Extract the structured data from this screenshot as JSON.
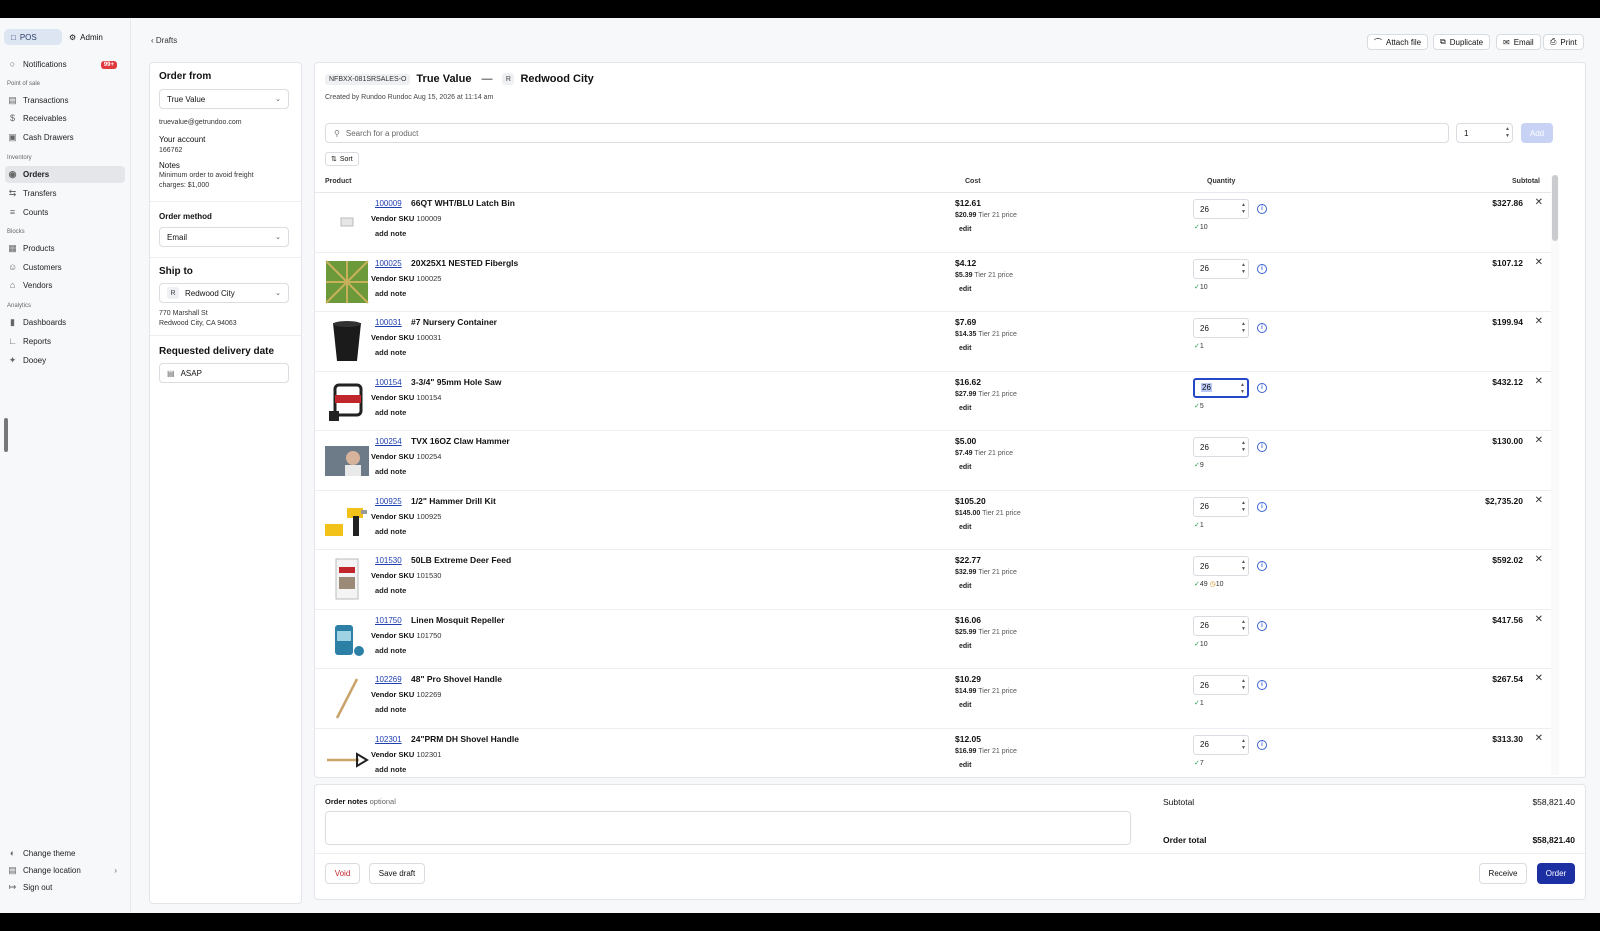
{
  "sidebar": {
    "pos_label": "POS",
    "admin_label": "Admin",
    "notifications_label": "Notifications",
    "notifications_badge": "99+",
    "section_pos": "Point of sale",
    "transactions": "Transactions",
    "receivables": "Receivables",
    "cash_drawers": "Cash Drawers",
    "section_inventory": "Inventory",
    "orders": "Orders",
    "transfers": "Transfers",
    "counts": "Counts",
    "section_blocks": "Blocks",
    "products": "Products",
    "customers": "Customers",
    "vendors": "Vendors",
    "section_analytics": "Analytics",
    "dashboards": "Dashboards",
    "reports": "Reports",
    "dooey": "Dooey",
    "change_theme": "Change theme",
    "change_location": "Change location",
    "sign_out": "Sign out"
  },
  "topbar": {
    "back_label": "Drafts",
    "attach_file": "Attach file",
    "duplicate": "Duplicate",
    "email": "Email",
    "print": "Print"
  },
  "left": {
    "order_from_title": "Order from",
    "vendor_value": "True Value",
    "vendor_email": "truevalue@getrundoo.com",
    "account_label": "Your account",
    "account_value": "166762",
    "notes_label": "Notes",
    "notes_value": "Minimum order to avoid freight charges: $1,000",
    "order_method_label": "Order method",
    "order_method_value": "Email",
    "ship_to_title": "Ship to",
    "ship_to_chip": "R",
    "ship_to_value": "Redwood City",
    "address_line1": "770 Marshall St",
    "address_line2": "Redwood City, CA 94063",
    "delivery_title": "Requested delivery date",
    "delivery_value": "ASAP"
  },
  "main": {
    "order_id": "NFBXX-081SRSALES-O",
    "vendor": "True Value",
    "dash": "—",
    "location_chip": "R",
    "location": "Redwood City",
    "created": "Created by Rundoo Rundoc Aug 15, 2026 at 11:14 am",
    "search_placeholder": "Search for a product",
    "add_qty": "1",
    "add_label": "Add",
    "sort_label": "Sort",
    "col_product": "Product",
    "col_cost": "Cost",
    "col_quantity": "Quantity",
    "col_subtotal": "Subtotal",
    "vendor_sku_label": "Vendor SKU",
    "add_note_label": "add note",
    "edit_label": "edit",
    "tier_suffix": "Tier 21 price"
  },
  "rows": [
    {
      "sku": "100009",
      "name": "66QT WHT/BLU Latch Bin",
      "cost": "$12.61",
      "tier": "$20.99",
      "qty": "26",
      "stock": "10",
      "stock2": "",
      "subtotal": "$327.86"
    },
    {
      "sku": "100025",
      "name": "20X25X1 NESTED Fibergls",
      "cost": "$4.12",
      "tier": "$5.39",
      "qty": "26",
      "stock": "10",
      "stock2": "",
      "subtotal": "$107.12"
    },
    {
      "sku": "100031",
      "name": "#7 Nursery Container",
      "cost": "$7.69",
      "tier": "$14.35",
      "qty": "26",
      "stock": "1",
      "stock2": "",
      "subtotal": "$199.94"
    },
    {
      "sku": "100154",
      "name": "3-3/4\" 95mm Hole Saw",
      "cost": "$16.62",
      "tier": "$27.99",
      "qty": "26",
      "stock": "5",
      "stock2": "",
      "subtotal": "$432.12"
    },
    {
      "sku": "100254",
      "name": "TVX 16OZ Claw Hammer",
      "cost": "$5.00",
      "tier": "$7.49",
      "qty": "26",
      "stock": "9",
      "stock2": "",
      "subtotal": "$130.00"
    },
    {
      "sku": "100925",
      "name": "1/2\" Hammer Drill Kit",
      "cost": "$105.20",
      "tier": "$145.00",
      "qty": "26",
      "stock": "1",
      "stock2": "",
      "subtotal": "$2,735.20"
    },
    {
      "sku": "101530",
      "name": "50LB Extreme Deer Feed",
      "cost": "$22.77",
      "tier": "$32.99",
      "qty": "26",
      "stock": "49",
      "stock2": "10",
      "subtotal": "$592.02"
    },
    {
      "sku": "101750",
      "name": "Linen Mosquit Repeller",
      "cost": "$16.06",
      "tier": "$25.99",
      "qty": "26",
      "stock": "10",
      "stock2": "",
      "subtotal": "$417.56"
    },
    {
      "sku": "102269",
      "name": "48\" Pro Shovel Handle",
      "cost": "$10.29",
      "tier": "$14.99",
      "qty": "26",
      "stock": "1",
      "stock2": "",
      "subtotal": "$267.54"
    },
    {
      "sku": "102301",
      "name": "24\"PRM DH Shovel Handle",
      "cost": "$12.05",
      "tier": "$16.99",
      "qty": "26",
      "stock": "7",
      "stock2": "",
      "subtotal": "$313.30"
    }
  ],
  "footer": {
    "order_notes_label": "Order notes",
    "optional": "optional",
    "subtotal_label": "Subtotal",
    "subtotal_value": "$58,821.40",
    "total_label": "Order total",
    "total_value": "$58,821.40",
    "void": "Void",
    "save_draft": "Save draft",
    "receive": "Receive",
    "order": "Order"
  },
  "colors": {
    "accent": "#1c2fa3",
    "badge": "#e0393e",
    "in_stock": "#2a9d4a"
  }
}
